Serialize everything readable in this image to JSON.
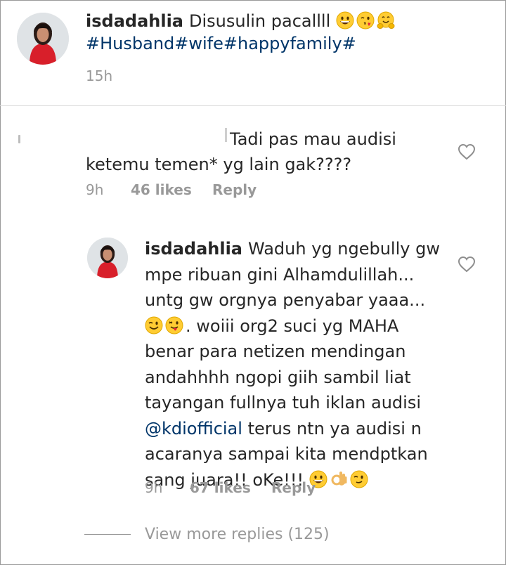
{
  "post": {
    "username": "isdadahlia",
    "caption": "Disusulin pacallll",
    "hashtags": "#Husband#wife#happyfamily#",
    "time": "15h",
    "emojis": [
      "grinning-face",
      "face-blowing-kiss",
      "hugging-face"
    ]
  },
  "comment": {
    "text_line1": "Tadi pas mau audisi",
    "text_line2": "ketemu temen* yg lain gak????",
    "time": "9h",
    "likes": "46 likes",
    "reply_label": "Reply"
  },
  "reply": {
    "username": "isdadahlia",
    "text_part1": "Waduh yg ngebully gw mpe ribuan gini Alhamdulillah... untg gw orgnya penyabar yaaa...",
    "text_part2": ". woiii org2 suci yg MAHA benar para netizen mendingan andahhhh ngopi giih sambil liat tayangan fullnya tuh iklan audisi",
    "mention": "@kdiofficial",
    "text_part3": "terus ntn ya audisi n acaranya sampai kita mendptkan sang juara!! oKe!!!",
    "time": "9h",
    "likes": "67 likes",
    "reply_label": "Reply",
    "emojis_mid": [
      "winking-face",
      "winking-face-with-tongue"
    ],
    "emojis_end": [
      "grinning-face",
      "ok-hand",
      "winking-face"
    ]
  },
  "view_more": {
    "label": "View more replies (125)"
  },
  "colors": {
    "hashtag": "#003569",
    "meta": "#999999",
    "text": "#262626",
    "divider": "#dbdbdb"
  }
}
